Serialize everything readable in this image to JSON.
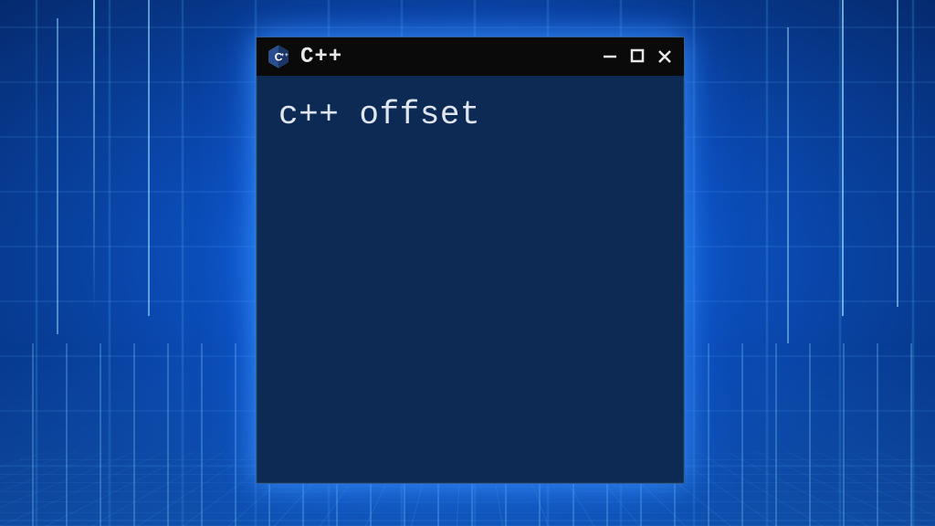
{
  "window": {
    "title": "C++",
    "icon_name": "cpp-logo-icon"
  },
  "content": {
    "text": "c++ offset"
  },
  "colors": {
    "window_bg": "#0d2a55",
    "titlebar_bg": "#0a0a0a",
    "text_color": "#e0e6ef",
    "glow": "#3c96ff"
  }
}
